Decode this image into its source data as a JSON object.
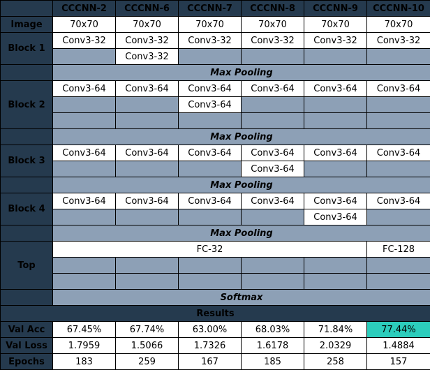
{
  "models": [
    "CCCNN-2",
    "CCCNN-6",
    "CCCNN-7",
    "CCCNN-8",
    "CCCNN-9",
    "CCCNN-10"
  ],
  "row_labels": {
    "image": "Image",
    "block1": "Block 1",
    "block2": "Block 2",
    "block3": "Block 3",
    "block4": "Block 4",
    "top": "Top",
    "val_acc": "Val Acc",
    "val_loss": "Val Loss",
    "epochs": "Epochs"
  },
  "image_size": [
    "70x70",
    "70x70",
    "70x70",
    "70x70",
    "70x70",
    "70x70"
  ],
  "conv32": "Conv3-32",
  "conv64": "Conv3-64",
  "pool": "Max Pooling",
  "fc32": "FC-32",
  "fc128": "FC-128",
  "softmax": "Softmax",
  "results_title": "Results",
  "val_acc": [
    "67.45%",
    "67.74%",
    "63.00%",
    "68.03%",
    "71.84%",
    "77.44%"
  ],
  "val_loss": [
    "1.7959",
    "1.5066",
    "1.7326",
    "1.6178",
    "2.0329",
    "1.4884"
  ],
  "epochs": [
    "183",
    "259",
    "167",
    "185",
    "258",
    "157"
  ],
  "colors": {
    "header_bg": "#253a4e",
    "empty_cell": "#8da0b6",
    "best_result": "#2ccdbc"
  }
}
